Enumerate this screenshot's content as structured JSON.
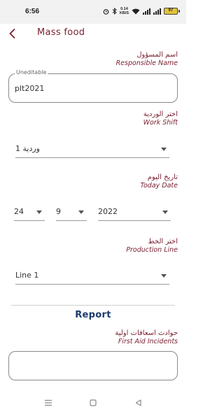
{
  "status_bar": {
    "time": "6:56",
    "net_speed_value": "0.14",
    "net_speed_unit": "KB/S",
    "battery": "97"
  },
  "header": {
    "title": "Mass food"
  },
  "responsible": {
    "label_ar": "اسم المسؤول",
    "label_en": "Responsible Name",
    "legend": "Uneditable",
    "value": "plt2021"
  },
  "shift": {
    "label_ar": "اختر الوردية",
    "label_en": "Work Shift",
    "value": "وردية 1"
  },
  "date": {
    "label_ar": "تاريخ اليوم",
    "label_en": "Today Date",
    "day": "24",
    "month": "9",
    "year": "2022"
  },
  "line": {
    "label_ar": "اختر الخط",
    "label_en": "Production Line",
    "value": "Line 1"
  },
  "report": {
    "title": "Report"
  },
  "first_aid": {
    "label_ar": "حوادث اسعافات اولية",
    "label_en": "First Aid Incidents",
    "value": ""
  }
}
